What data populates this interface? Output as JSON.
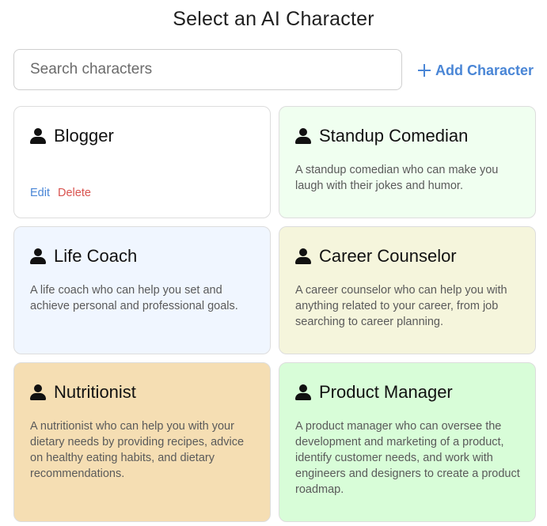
{
  "page": {
    "title": "Select an AI Character"
  },
  "search": {
    "placeholder": "Search characters"
  },
  "add_button": {
    "label": "Add Character",
    "icon": "plus-icon",
    "color": "#4a86d6"
  },
  "cards": [
    {
      "name": "Blogger",
      "description": "",
      "background": "#ffffff",
      "icon": "person-icon",
      "actions": {
        "edit": "Edit",
        "delete": "Delete"
      }
    },
    {
      "name": "Standup Comedian",
      "description": "A standup comedian who can make you laugh with their jokes and humor.",
      "background": "#f0fff0",
      "icon": "person-icon"
    },
    {
      "name": "Life Coach",
      "description": "A life coach who can help you set and achieve personal and professional goals.",
      "background": "#f0f6ff",
      "icon": "person-icon"
    },
    {
      "name": "Career Counselor",
      "description": "A career counselor who can help you with anything related to your career, from job searching to career planning.",
      "background": "#f5f5dc",
      "icon": "person-icon"
    },
    {
      "name": "Nutritionist",
      "description": "A nutritionist who can help you with your dietary needs by providing recipes, advice on healthy eating habits, and dietary recommendations.",
      "background": "#f5deb3",
      "icon": "person-icon"
    },
    {
      "name": "Product Manager",
      "description": "A product manager who can oversee the development and marketing of a product, identify customer needs, and work with engineers and designers to create a product roadmap.",
      "background": "#d8fdd8",
      "icon": "person-icon"
    }
  ]
}
